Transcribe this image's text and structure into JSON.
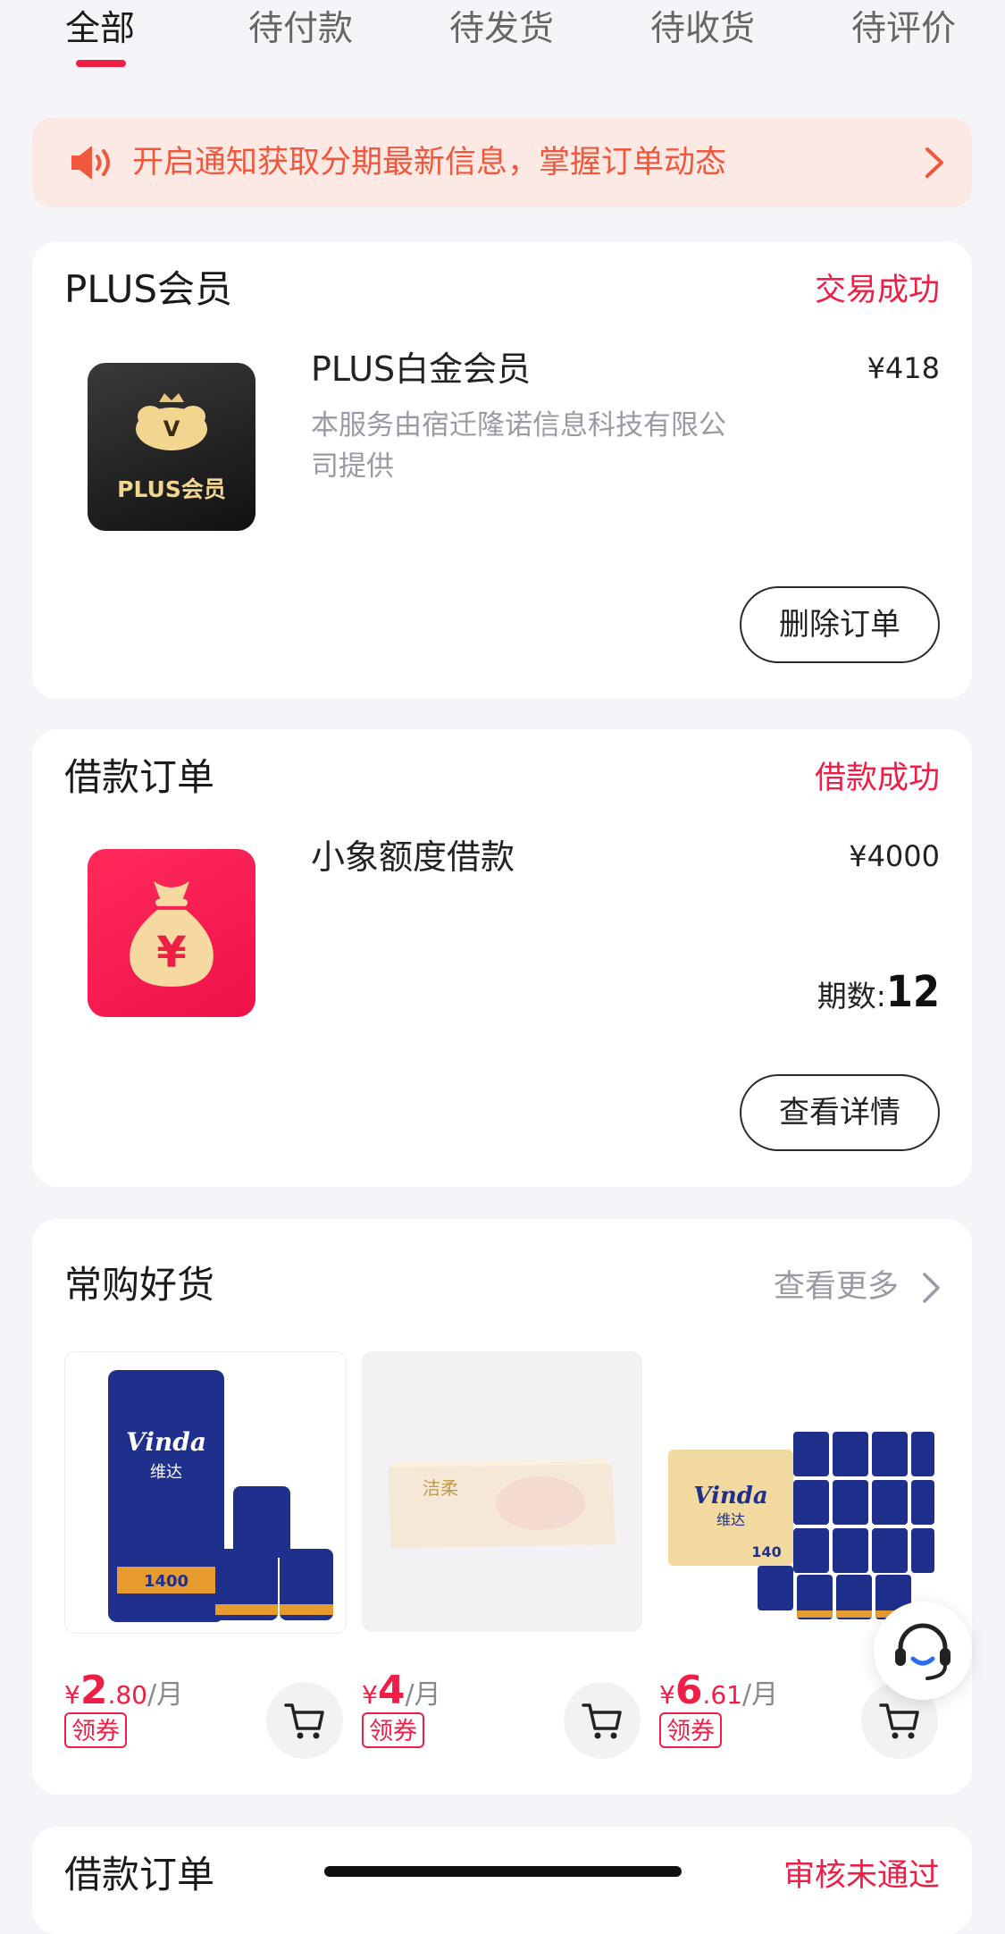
{
  "tabs": [
    {
      "label": "全部",
      "active": true
    },
    {
      "label": "待付款"
    },
    {
      "label": "待发货"
    },
    {
      "label": "待收货"
    },
    {
      "label": "待评价"
    }
  ],
  "notice": {
    "text": "开启通知获取分期最新信息，掌握订单动态",
    "icon": "speaker-icon"
  },
  "orders": [
    {
      "title": "PLUS会员",
      "status": "交易成功",
      "item": {
        "name": "PLUS白金会员",
        "description": "本服务由宿迁隆诺信息科技有限公司提供",
        "price": "¥418",
        "thumb_text": "PLUS会员",
        "thumb_badge": "V"
      },
      "action": "删除订单"
    },
    {
      "title": "借款订单",
      "status": "借款成功",
      "item": {
        "name": "小象额度借款",
        "price": "¥4000",
        "term_label": "期数:",
        "term_value": "12",
        "thumb_symbol": "¥"
      },
      "action": "查看详情"
    }
  ],
  "recommend": {
    "title": "常购好货",
    "more": "查看更多",
    "products": [
      {
        "currency": "¥",
        "int": "2",
        "dec": ".80",
        "unit": "/月",
        "coupon": "领券",
        "brand": "Vinda",
        "sub": "维达",
        "spec": "1400"
      },
      {
        "currency": "¥",
        "int": "4",
        "dec": "",
        "unit": "/月",
        "coupon": "领券",
        "brand": "洁柔"
      },
      {
        "currency": "¥",
        "int": "6",
        "dec": ".61",
        "unit": "/月",
        "coupon": "领券",
        "brand": "Vinda",
        "sub": "维达",
        "spec": "140"
      }
    ]
  },
  "next_order": {
    "title": "借款订单",
    "status": "审核未通过"
  },
  "colors": {
    "accent": "#ef1e46",
    "notice_bg": "#fde9e3",
    "notice_text": "#f0573d",
    "page_bg": "#f5f5f9"
  }
}
